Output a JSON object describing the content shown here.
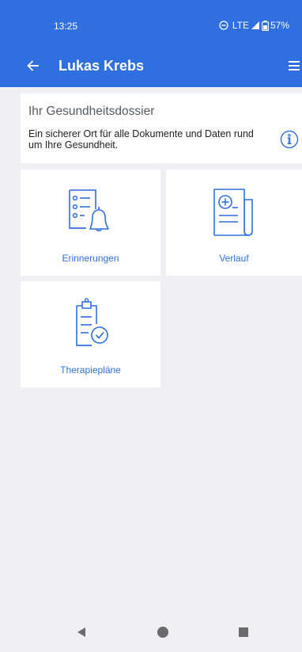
{
  "status_bar": {
    "time": "13:25",
    "network": "LTE",
    "battery": "57%"
  },
  "app_bar": {
    "title": "Lukas Krebs",
    "back_icon": "arrow-left-icon",
    "menu_icon": "hamburger-menu-icon"
  },
  "info_card": {
    "title": "Ihr Gesundheitsdossier",
    "description": "Ein sicherer Ort für alle Dokumente und Daten rund um Ihre Gesundheit.",
    "icon": "info-icon"
  },
  "tiles": [
    {
      "label": "Erinnerungen",
      "icon": "reminder-list-bell-icon"
    },
    {
      "label": "Verlauf",
      "icon": "medical-record-history-icon"
    },
    {
      "label": "Therapiepläne",
      "icon": "clipboard-check-icon"
    }
  ],
  "colors": {
    "primary": "#2f6fe0",
    "background": "#efeff4",
    "card": "#ffffff"
  }
}
